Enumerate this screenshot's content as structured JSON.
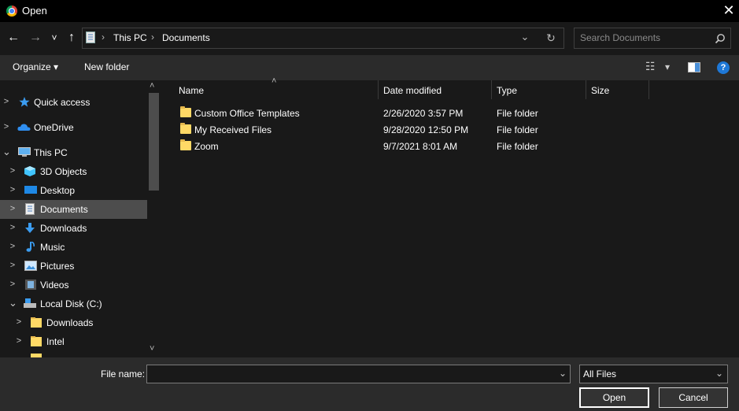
{
  "window": {
    "title": "Open",
    "close_glyph": "✕"
  },
  "nav": {
    "back": "←",
    "forward": "→",
    "recent": "˅",
    "up": "↑",
    "breadcrumb": [
      "This PC",
      "Documents"
    ],
    "separator": "›",
    "refresh": "↻",
    "dropdown": "⌄",
    "search_placeholder": "Search Documents"
  },
  "commands": {
    "organize": "Organize ▾",
    "new_folder": "New folder",
    "view_glyph": "☷",
    "view_dd": "▾",
    "help_glyph": "?"
  },
  "sidebar": {
    "items": [
      {
        "label": "Quick access",
        "icon": "star-icon",
        "chevron": ">"
      },
      {
        "label": "OneDrive",
        "icon": "cloud-icon",
        "chevron": ">"
      },
      {
        "label": "This PC",
        "icon": "computer-icon",
        "chevron": "⌄"
      },
      {
        "label": "3D Objects",
        "icon": "cube-icon",
        "chevron": ">"
      },
      {
        "label": "Desktop",
        "icon": "desktop-icon",
        "chevron": ">"
      },
      {
        "label": "Documents",
        "icon": "document-icon",
        "chevron": ">"
      },
      {
        "label": "Downloads",
        "icon": "download-icon",
        "chevron": ">"
      },
      {
        "label": "Music",
        "icon": "music-icon",
        "chevron": ">"
      },
      {
        "label": "Pictures",
        "icon": "picture-icon",
        "chevron": ">"
      },
      {
        "label": "Videos",
        "icon": "video-icon",
        "chevron": ">"
      },
      {
        "label": "Local Disk (C:)",
        "icon": "drive-icon",
        "chevron": "⌄"
      },
      {
        "label": "Downloads",
        "icon": "folder-icon",
        "chevron": ">"
      },
      {
        "label": "Intel",
        "icon": "folder-icon",
        "chevron": ">"
      }
    ],
    "selected": "Documents",
    "scroll_up": "˄",
    "scroll_down": "˅"
  },
  "columns": [
    "Name",
    "Date modified",
    "Type",
    "Size"
  ],
  "sort_glyph": "˄",
  "files": [
    {
      "name": "Custom Office Templates",
      "date": "2/26/2020 3:57 PM",
      "type": "File folder",
      "size": ""
    },
    {
      "name": "My Received Files",
      "date": "9/28/2020 12:50 PM",
      "type": "File folder",
      "size": ""
    },
    {
      "name": "Zoom",
      "date": "9/7/2021 8:01 AM",
      "type": "File folder",
      "size": ""
    }
  ],
  "footer": {
    "file_name_label": "File name:",
    "file_name_value": "",
    "file_type": "All Files",
    "open": "Open",
    "cancel": "Cancel",
    "dd_glyph": "⌄"
  },
  "colors": {
    "background": "#191919",
    "titlebar": "#000000",
    "panel": "#2b2b2b",
    "selected": "#4d4d4d",
    "folder": "#ffd966",
    "accent": "#1e90ff"
  }
}
